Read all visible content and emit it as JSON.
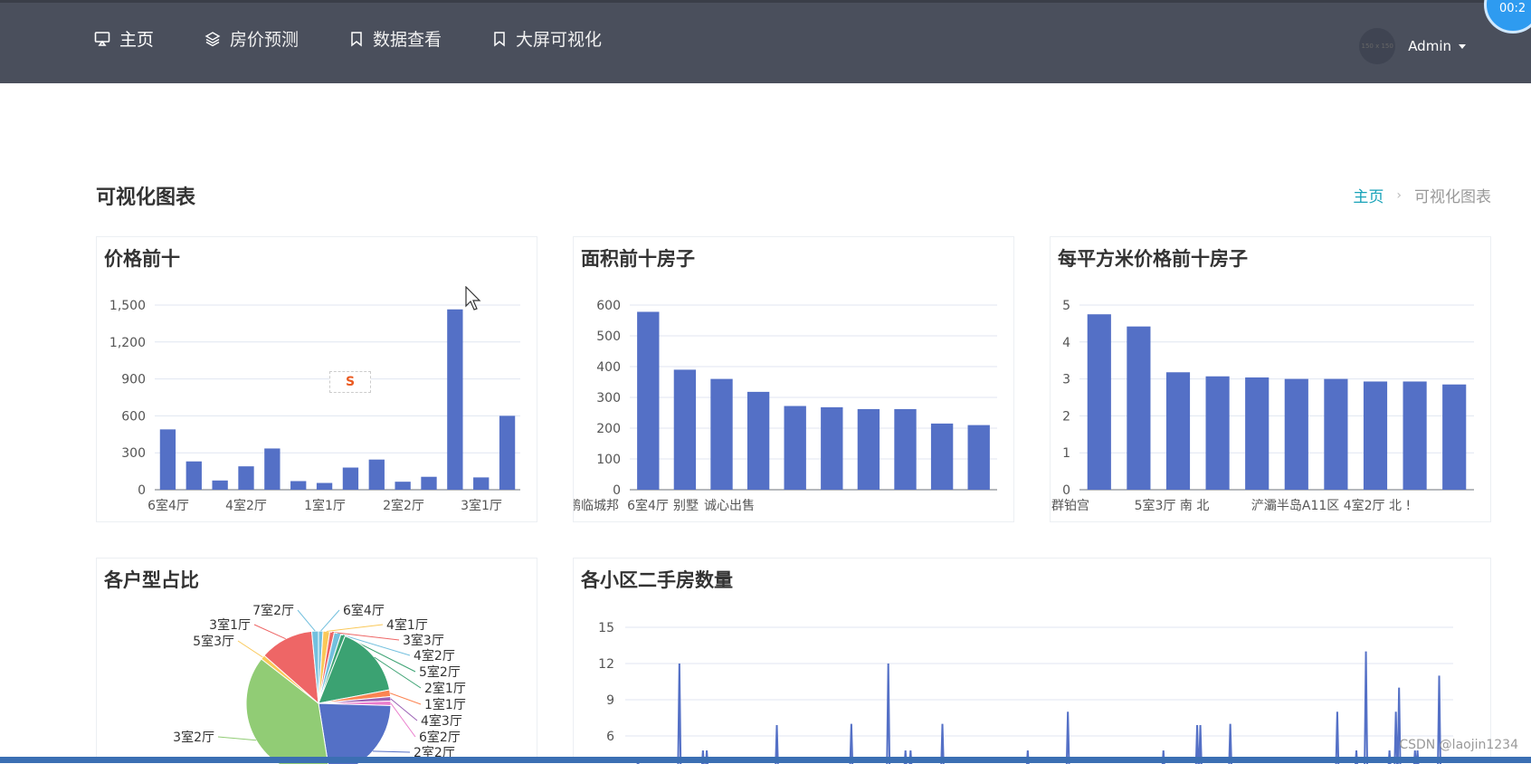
{
  "nav": {
    "items": [
      {
        "label": "主页",
        "icon": "monitor-icon"
      },
      {
        "label": "房价预测",
        "icon": "layers-icon"
      },
      {
        "label": "数据查看",
        "icon": "bookmark-icon"
      },
      {
        "label": "大屏可视化",
        "icon": "bookmark-icon"
      }
    ],
    "user": {
      "name": "Admin",
      "avatar_text": "150 x 150"
    },
    "timer_text": "00:2"
  },
  "page": {
    "title": "可视化图表"
  },
  "breadcrumb": {
    "home": "主页",
    "current": "可视化图表"
  },
  "colors": {
    "bar": "#5470c6",
    "nav_bg": "#4a4f5c",
    "accent": "#17a2b8"
  },
  "ime_text": "S",
  "watermark": "CSDN @laojin1234",
  "chart_data": [
    {
      "id": "price-top10",
      "type": "bar",
      "title": "价格前十",
      "categories": [
        "6室4厅",
        "",
        "4室2厅",
        "",
        "1室1厅",
        "",
        "2室2厅",
        "",
        "3室1厅",
        ""
      ],
      "values": [
        490,
        230,
        75,
        190,
        335,
        70,
        55,
        180,
        245,
        65,
        105,
        1465,
        100,
        600
      ],
      "xtick_labels": [
        "6室4厅",
        "4室2厅",
        "1室1厅",
        "2室2厅",
        "3室1厅"
      ],
      "yticks": [
        0,
        300,
        600,
        900,
        1200,
        1500
      ],
      "ylim": [
        0,
        1500
      ],
      "grid": true
    },
    {
      "id": "area-top10",
      "type": "bar",
      "title": "面积前十房子",
      "values": [
        578,
        390,
        360,
        318,
        272,
        268,
        262,
        262,
        215,
        210
      ],
      "xtick_labels": [
        "鹏临城邦",
        "6室4厅",
        "别墅",
        "诚心出售"
      ],
      "yticks": [
        0,
        100,
        200,
        300,
        400,
        500,
        600
      ],
      "ylim": [
        0,
        600
      ],
      "grid": true
    },
    {
      "id": "unit-price-top10",
      "type": "bar",
      "title": "每平方米价格前十房子",
      "values": [
        4.75,
        4.42,
        3.18,
        3.07,
        3.04,
        3.0,
        3.0,
        2.93,
        2.93,
        2.85
      ],
      "xtick_labels": [
        "群铂宫",
        "5室3厅 南 北",
        "浐灞半岛A11区 4室2厅 北 !"
      ],
      "yticks": [
        0,
        1,
        2,
        3,
        4,
        5
      ],
      "ylim": [
        0,
        5
      ],
      "grid": true
    },
    {
      "id": "layout-ratio",
      "type": "pie",
      "title": "各户型占比",
      "slices": [
        {
          "name": "6室4厅",
          "value": 1,
          "color": "#73c0de"
        },
        {
          "name": "4室1厅",
          "value": 1.5,
          "color": "#fac858"
        },
        {
          "name": "3室3厅",
          "value": 1,
          "color": "#ee6666"
        },
        {
          "name": "4室2厅",
          "value": 1.5,
          "color": "#73c0de"
        },
        {
          "name": "5室2厅",
          "value": 1,
          "color": "#3ba272"
        },
        {
          "name": "2室1厅",
          "value": 16,
          "color": "#3ba272"
        },
        {
          "name": "1室1厅",
          "value": 1.5,
          "color": "#fc8452"
        },
        {
          "name": "4室3厅",
          "value": 1,
          "color": "#9a60b4"
        },
        {
          "name": "6室2厅",
          "value": 1,
          "color": "#ea7ccc"
        },
        {
          "name": "2室2厅",
          "value": 22,
          "color": "#5470c6"
        },
        {
          "name": "3室2厅",
          "value": 38,
          "color": "#91cc75"
        },
        {
          "name": "5室3厅",
          "value": 1,
          "color": "#fac858"
        },
        {
          "name": "3室1厅",
          "value": 12,
          "color": "#ee6666"
        },
        {
          "name": "7室2厅",
          "value": 1.5,
          "color": "#73c0de"
        }
      ]
    },
    {
      "id": "community-count",
      "type": "line",
      "title": "各小区二手房数量",
      "yticks": [
        6,
        9,
        12,
        15
      ],
      "ylim": [
        3,
        15
      ],
      "spikes": [
        [
          0.02,
          4
        ],
        [
          0.085,
          12
        ],
        [
          0.105,
          3.6
        ],
        [
          0.122,
          4.8
        ],
        [
          0.128,
          4.8
        ],
        [
          0.148,
          3.6
        ],
        [
          0.238,
          6.9
        ],
        [
          0.25,
          3.6
        ],
        [
          0.295,
          3.6
        ],
        [
          0.343,
          3.6
        ],
        [
          0.355,
          7
        ],
        [
          0.413,
          12
        ],
        [
          0.428,
          3.6
        ],
        [
          0.44,
          4.8
        ],
        [
          0.448,
          4.8
        ],
        [
          0.468,
          3.6
        ],
        [
          0.498,
          7
        ],
        [
          0.632,
          4.8
        ],
        [
          0.695,
          8
        ],
        [
          0.718,
          3.6
        ],
        [
          0.755,
          3.6
        ],
        [
          0.845,
          4.8
        ],
        [
          0.898,
          6.9
        ],
        [
          0.903,
          6.9
        ],
        [
          0.95,
          7
        ],
        [
          1.118,
          8
        ],
        [
          1.148,
          4.8
        ],
        [
          1.163,
          13
        ],
        [
          1.2,
          4.8
        ],
        [
          1.21,
          8
        ],
        [
          1.215,
          10
        ],
        [
          1.223,
          3.6
        ],
        [
          1.24,
          4.8
        ],
        [
          1.244,
          4.8
        ],
        [
          1.278,
          11
        ]
      ]
    }
  ]
}
